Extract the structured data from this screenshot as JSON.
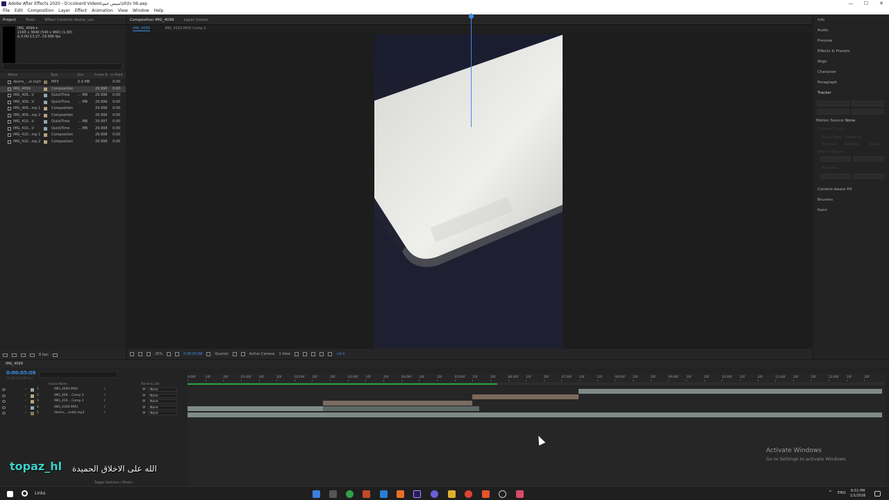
{
  "app": {
    "title": "Adobe After Effects 2020 - D:\\coloerd Videos\\سيس جيم\\UI\\tv 06.aep",
    "window_controls": [
      "—",
      "☐",
      "✕"
    ],
    "menu": [
      "File",
      "Edit",
      "Composition",
      "Layer",
      "Effect",
      "Animation",
      "View",
      "Window",
      "Help"
    ]
  },
  "project_panel": {
    "tabs": [
      "Project",
      "Tools",
      "Effect Controls desire_usc"
    ],
    "selected_item": "IMG_4099 ▾",
    "info_lines": [
      "2160 x 3840 (540 x 960) (1.00)",
      "Δ 0:00:13:27, 29.996 fps"
    ],
    "columns": [
      "Name",
      "Type",
      "Size",
      "Frame R...",
      "In Point"
    ],
    "items": [
      {
        "name": "desire_...al.mp3",
        "type": "MP3",
        "size": "6.9 MB",
        "fps": "",
        "in": "0:00",
        "label_color": "#8b7a5a"
      },
      {
        "name": "IMG_4099",
        "type": "Composition",
        "size": "",
        "fps": "29.996",
        "in": "0:00",
        "label_color": "#b8a483",
        "selected": true
      },
      {
        "name": "IMG_409...V",
        "type": "QuickTime",
        "size": "... MB",
        "fps": "29.996",
        "in": "0:00",
        "label_color": "#8fa7b0"
      },
      {
        "name": "IMG_409...V",
        "type": "QuickTime",
        "size": "... MB",
        "fps": "29.996",
        "in": "0:00",
        "label_color": "#8fa7b0"
      },
      {
        "name": "IMG_409...mp 1",
        "type": "Composition",
        "size": "",
        "fps": "29.996",
        "in": "0:00",
        "label_color": "#b8a483"
      },
      {
        "name": "IMG_409...mp 2",
        "type": "Composition",
        "size": "",
        "fps": "29.996",
        "in": "0:00",
        "label_color": "#b8a483"
      },
      {
        "name": "IMG_410...V",
        "type": "QuickTime",
        "size": "... MB",
        "fps": "29.997",
        "in": "0:00",
        "label_color": "#8fa7b0"
      },
      {
        "name": "IMG_410...V",
        "type": "QuickTime",
        "size": "... MB",
        "fps": "29.998",
        "in": "0:00",
        "label_color": "#8fa7b0"
      },
      {
        "name": "IMG_410...mp 1",
        "type": "Composition",
        "size": "",
        "fps": "29.998",
        "in": "0:00",
        "label_color": "#b8a483"
      },
      {
        "name": "IMG_410...mp 2",
        "type": "Composition",
        "size": "",
        "fps": "29.998",
        "in": "0:00",
        "label_color": "#b8a483"
      }
    ],
    "footer_bpc": "8 bpc"
  },
  "composition_panel": {
    "tab": "Composition IMG_4099",
    "layer_tab": "Layer (none)",
    "subtabs": [
      "IMG_4099",
      "IMG_4102.MOV Comp 2"
    ],
    "toolbar": {
      "zoom": "25%",
      "timecode": "0:00:05:08",
      "resolution": "Quarter",
      "camera": "Active Camera",
      "views": "1 View",
      "exposure": "+0.0"
    }
  },
  "right_panel": {
    "items": [
      "Info",
      "Audio",
      "Preview",
      "Effects & Presets",
      "Align",
      "Character",
      "Paragraph",
      "Tracker",
      "Content-Aware Fill",
      "Brushes",
      "Paint"
    ],
    "tracker": {
      "buttons": [
        "Track Camera",
        "Warp Stabilizer",
        "Track Motion",
        "Stabilize Motion"
      ],
      "motion_source_label": "Motion Source:",
      "motion_source_value": "None",
      "current_track_label": "Current Track:",
      "current_track_value": "None",
      "track_type_label": "Track Type:",
      "track_type_value": "Stabilize",
      "options": [
        "Position",
        "Rotation",
        "Scale"
      ],
      "motion_target": "Motion Target:",
      "edit_target": "Edit Target...",
      "options_btn": "Options...",
      "analyze": "Analyze:",
      "reset": "Reset",
      "apply": "Apply"
    }
  },
  "timeline": {
    "tab": "IMG_4099",
    "timecode": "0:00:05:08",
    "fps_line": "00160 (29.996 fps)",
    "col_source": "Source Name",
    "col_parent": "Parent & Link",
    "ruler": [
      "0:00f",
      "10f",
      "20f",
      "01:00f",
      "10f",
      "20f",
      "02:00f",
      "10f",
      "20f",
      "03:00f",
      "10f",
      "20f",
      "04:00f",
      "10f",
      "20f",
      "05:00f",
      "10f",
      "20f",
      "06:00f",
      "10f",
      "20f",
      "07:00f",
      "10f",
      "20f",
      "08:00f",
      "10f",
      "20f",
      "09:00f",
      "10f",
      "20f",
      "10:00f",
      "10f",
      "20f",
      "11:00f",
      "10f",
      "20f",
      "12:00f",
      "10f",
      "20f"
    ],
    "layers": [
      {
        "num": "1",
        "name": "IMG_4093.MOV",
        "parent": "None",
        "color": "#8fa7b0",
        "fx": false
      },
      {
        "num": "2",
        "name": "IMG_409... Comp 2",
        "parent": "None",
        "color": "#b8a483",
        "fx": true
      },
      {
        "num": "3",
        "name": "IMG_410... Comp 2",
        "parent": "None",
        "color": "#b8a483",
        "fx": true
      },
      {
        "num": "4",
        "name": "IMG_4100.MOV",
        "parent": "None",
        "color": "#8fa7b0",
        "fx": false
      },
      {
        "num": "5",
        "name": "desire_...ental.mp3",
        "parent": "None",
        "color": "#8b7a5a",
        "fx": false
      }
    ],
    "toggle_label": "Toggle Switches / Modes"
  },
  "overlay": {
    "watermark_en": "topaz_hl",
    "watermark_ar": "الله على الاخلاق الحميدة",
    "activate_title": "Activate Windows",
    "activate_sub": "Go to Settings to activate Windows."
  },
  "taskbar": {
    "search": "Links",
    "lang": "ENG",
    "time": "6:51 PM",
    "date": "1/1/2026"
  },
  "colors": {
    "accent": "#3b8ee9",
    "workarea": "#27a243"
  }
}
